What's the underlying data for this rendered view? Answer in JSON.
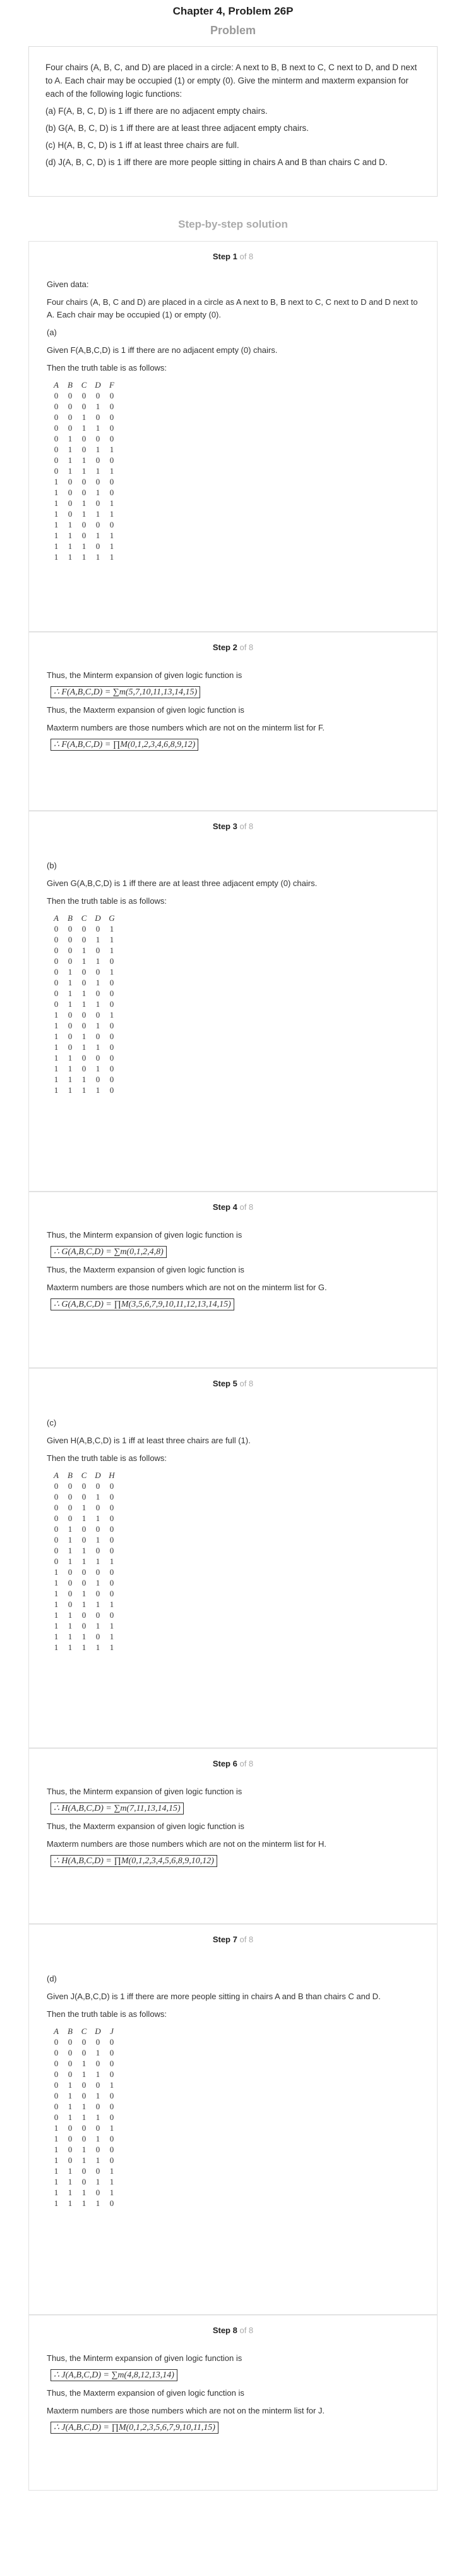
{
  "header": {
    "title": "Chapter 4, Problem 26P"
  },
  "problem": {
    "title": "Problem",
    "lines": [
      "Four chairs (A, B, C, and D) are placed in a circle: A next to B, B next to C, C next to D, and D next to A. Each chair may be occupied (1) or empty (0). Give the minterm and maxterm expansion for each of the following logic functions:",
      "(a) F(A, B, C, D) is 1 iff there are no adjacent empty chairs.",
      "(b) G(A, B, C, D) is 1 iff there are at least three adjacent empty chairs.",
      "(c) H(A, B, C, D) is 1 iff at least three chairs are full.",
      "(d) J(A, B, C, D) is 1 iff there are more people sitting in chairs A and B than chairs C and D."
    ]
  },
  "solution_title": "Step-by-step solution",
  "step_total": "of 8",
  "steps": {
    "s1": {
      "label": "Step 1",
      "given_data": "Given data:",
      "intro": "Four chairs (A, B, C and D) are placed in a circle as A next to B, B next to C, C next to D and D next to A. Each chair may be occupied (1) or empty (0).",
      "part": "(a)",
      "given": "Given F(A,B,C,D) is 1 iff there are no adjacent empty (0) chairs.",
      "table_intro": "Then the truth table is as follows:",
      "headers": [
        "A",
        "B",
        "C",
        "D",
        "F"
      ],
      "rows": [
        [
          "0",
          "0",
          "0",
          "0",
          "0"
        ],
        [
          "0",
          "0",
          "0",
          "1",
          "0"
        ],
        [
          "0",
          "0",
          "1",
          "0",
          "0"
        ],
        [
          "0",
          "0",
          "1",
          "1",
          "0"
        ],
        [
          "0",
          "1",
          "0",
          "0",
          "0"
        ],
        [
          "0",
          "1",
          "0",
          "1",
          "1"
        ],
        [
          "0",
          "1",
          "1",
          "0",
          "0"
        ],
        [
          "0",
          "1",
          "1",
          "1",
          "1"
        ],
        [
          "1",
          "0",
          "0",
          "0",
          "0"
        ],
        [
          "1",
          "0",
          "0",
          "1",
          "0"
        ],
        [
          "1",
          "0",
          "1",
          "0",
          "1"
        ],
        [
          "1",
          "0",
          "1",
          "1",
          "1"
        ],
        [
          "1",
          "1",
          "0",
          "0",
          "0"
        ],
        [
          "1",
          "1",
          "0",
          "1",
          "1"
        ],
        [
          "1",
          "1",
          "1",
          "0",
          "1"
        ],
        [
          "1",
          "1",
          "1",
          "1",
          "1"
        ]
      ]
    },
    "s2": {
      "label": "Step 2",
      "minterm_text": "Thus, the Minterm expansion of given logic function is",
      "minterm": "∴ F(A,B,C,D) = ∑m(5,7,10,11,13,14,15)",
      "maxterm_text": "Thus, the Maxterm expansion of given logic function is",
      "maxterm_note": "Maxterm numbers are those numbers which are not on the minterm list for F.",
      "maxterm": "∴ F(A,B,C,D) = ∏M(0,1,2,3,4,6,8,9,12)"
    },
    "s3": {
      "label": "Step 3",
      "part": "(b)",
      "given": "Given G(A,B,C,D) is 1 iff there are at least three adjacent empty (0) chairs.",
      "table_intro": "Then the truth table is as follows:",
      "headers": [
        "A",
        "B",
        "C",
        "D",
        "G"
      ],
      "rows": [
        [
          "0",
          "0",
          "0",
          "0",
          "1"
        ],
        [
          "0",
          "0",
          "0",
          "1",
          "1"
        ],
        [
          "0",
          "0",
          "1",
          "0",
          "1"
        ],
        [
          "0",
          "0",
          "1",
          "1",
          "0"
        ],
        [
          "0",
          "1",
          "0",
          "0",
          "1"
        ],
        [
          "0",
          "1",
          "0",
          "1",
          "0"
        ],
        [
          "0",
          "1",
          "1",
          "0",
          "0"
        ],
        [
          "0",
          "1",
          "1",
          "1",
          "0"
        ],
        [
          "1",
          "0",
          "0",
          "0",
          "1"
        ],
        [
          "1",
          "0",
          "0",
          "1",
          "0"
        ],
        [
          "1",
          "0",
          "1",
          "0",
          "0"
        ],
        [
          "1",
          "0",
          "1",
          "1",
          "0"
        ],
        [
          "1",
          "1",
          "0",
          "0",
          "0"
        ],
        [
          "1",
          "1",
          "0",
          "1",
          "0"
        ],
        [
          "1",
          "1",
          "1",
          "0",
          "0"
        ],
        [
          "1",
          "1",
          "1",
          "1",
          "0"
        ]
      ]
    },
    "s4": {
      "label": "Step 4",
      "minterm_text": "Thus, the Minterm expansion of given logic function is",
      "minterm": "∴ G(A,B,C,D) = ∑m(0,1,2,4,8)",
      "maxterm_text": "Thus, the Maxterm expansion of given logic function is",
      "maxterm_note": "Maxterm numbers are those numbers which are not on the minterm list for G.",
      "maxterm": "∴ G(A,B,C,D) = ∏M(3,5,6,7,9,10,11,12,13,14,15)"
    },
    "s5": {
      "label": "Step 5",
      "part": "(c)",
      "given": "Given H(A,B,C,D) is 1 iff at least three chairs are full (1).",
      "table_intro": "Then the truth table is as follows:",
      "headers": [
        "A",
        "B",
        "C",
        "D",
        "H"
      ],
      "rows": [
        [
          "0",
          "0",
          "0",
          "0",
          "0"
        ],
        [
          "0",
          "0",
          "0",
          "1",
          "0"
        ],
        [
          "0",
          "0",
          "1",
          "0",
          "0"
        ],
        [
          "0",
          "0",
          "1",
          "1",
          "0"
        ],
        [
          "0",
          "1",
          "0",
          "0",
          "0"
        ],
        [
          "0",
          "1",
          "0",
          "1",
          "0"
        ],
        [
          "0",
          "1",
          "1",
          "0",
          "0"
        ],
        [
          "0",
          "1",
          "1",
          "1",
          "1"
        ],
        [
          "1",
          "0",
          "0",
          "0",
          "0"
        ],
        [
          "1",
          "0",
          "0",
          "1",
          "0"
        ],
        [
          "1",
          "0",
          "1",
          "0",
          "0"
        ],
        [
          "1",
          "0",
          "1",
          "1",
          "1"
        ],
        [
          "1",
          "1",
          "0",
          "0",
          "0"
        ],
        [
          "1",
          "1",
          "0",
          "1",
          "1"
        ],
        [
          "1",
          "1",
          "1",
          "0",
          "1"
        ],
        [
          "1",
          "1",
          "1",
          "1",
          "1"
        ]
      ]
    },
    "s6": {
      "label": "Step 6",
      "minterm_text": "Thus, the Minterm expansion of given logic function is",
      "minterm": "∴ H(A,B,C,D) = ∑m(7,11,13,14,15)",
      "maxterm_text": "Thus, the Maxterm expansion of given logic function is",
      "maxterm_note": "Maxterm numbers are those numbers which are not on the minterm list for H.",
      "maxterm": "∴ H(A,B,C,D) = ∏M(0,1,2,3,4,5,6,8,9,10,12)"
    },
    "s7": {
      "label": "Step 7",
      "part": "(d)",
      "given": "Given J(A,B,C,D) is 1 iff there are more people sitting in chairs A and B than chairs C and D.",
      "table_intro": "Then the truth table is as follows:",
      "headers": [
        "A",
        "B",
        "C",
        "D",
        "J"
      ],
      "rows": [
        [
          "0",
          "0",
          "0",
          "0",
          "0"
        ],
        [
          "0",
          "0",
          "0",
          "1",
          "0"
        ],
        [
          "0",
          "0",
          "1",
          "0",
          "0"
        ],
        [
          "0",
          "0",
          "1",
          "1",
          "0"
        ],
        [
          "0",
          "1",
          "0",
          "0",
          "1"
        ],
        [
          "0",
          "1",
          "0",
          "1",
          "0"
        ],
        [
          "0",
          "1",
          "1",
          "0",
          "0"
        ],
        [
          "0",
          "1",
          "1",
          "1",
          "0"
        ],
        [
          "1",
          "0",
          "0",
          "0",
          "1"
        ],
        [
          "1",
          "0",
          "0",
          "1",
          "0"
        ],
        [
          "1",
          "0",
          "1",
          "0",
          "0"
        ],
        [
          "1",
          "0",
          "1",
          "1",
          "0"
        ],
        [
          "1",
          "1",
          "0",
          "0",
          "1"
        ],
        [
          "1",
          "1",
          "0",
          "1",
          "1"
        ],
        [
          "1",
          "1",
          "1",
          "0",
          "1"
        ],
        [
          "1",
          "1",
          "1",
          "1",
          "0"
        ]
      ]
    },
    "s8": {
      "label": "Step 8",
      "minterm_text": "Thus, the Minterm expansion of given logic function is",
      "minterm": "∴ J(A,B,C,D) = ∑m(4,8,12,13,14)",
      "maxterm_text": "Thus, the Maxterm expansion of given logic function is",
      "maxterm_note": "Maxterm numbers are those numbers which are not on the minterm list for J.",
      "maxterm": "∴ J(A,B,C,D) = ∏M(0,1,2,3,5,6,7,9,10,11,15)"
    }
  }
}
